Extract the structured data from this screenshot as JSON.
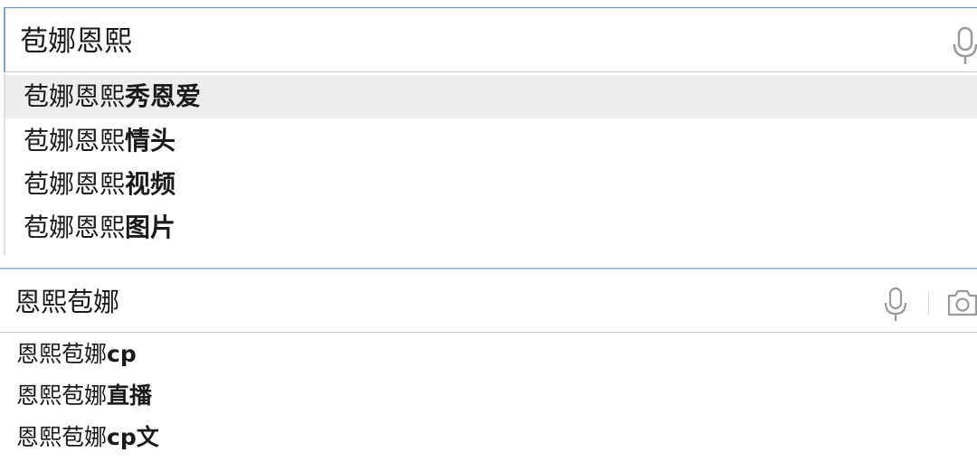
{
  "panel1": {
    "query": "苞娜恩熙",
    "mic_icon": "microphone-icon",
    "suggestions": [
      {
        "prefix": "苞娜恩熙",
        "suffix": "秀恩爱"
      },
      {
        "prefix": "苞娜恩熙",
        "suffix": "情头"
      },
      {
        "prefix": "苞娜恩熙",
        "suffix": "视频"
      },
      {
        "prefix": "苞娜恩熙",
        "suffix": "图片"
      }
    ],
    "highlight_color": "#eeeeee",
    "border_color": "#5b87c4"
  },
  "panel2": {
    "query": "恩熙苞娜",
    "mic_icon": "microphone-icon",
    "camera_icon": "camera-icon",
    "suggestions": [
      {
        "prefix": "恩熙苞娜",
        "suffix": "cp"
      },
      {
        "prefix": "恩熙苞娜",
        "suffix": "直播"
      },
      {
        "prefix": "恩熙苞娜",
        "suffix": "cp文"
      }
    ],
    "border_color": "#a7c0df"
  }
}
